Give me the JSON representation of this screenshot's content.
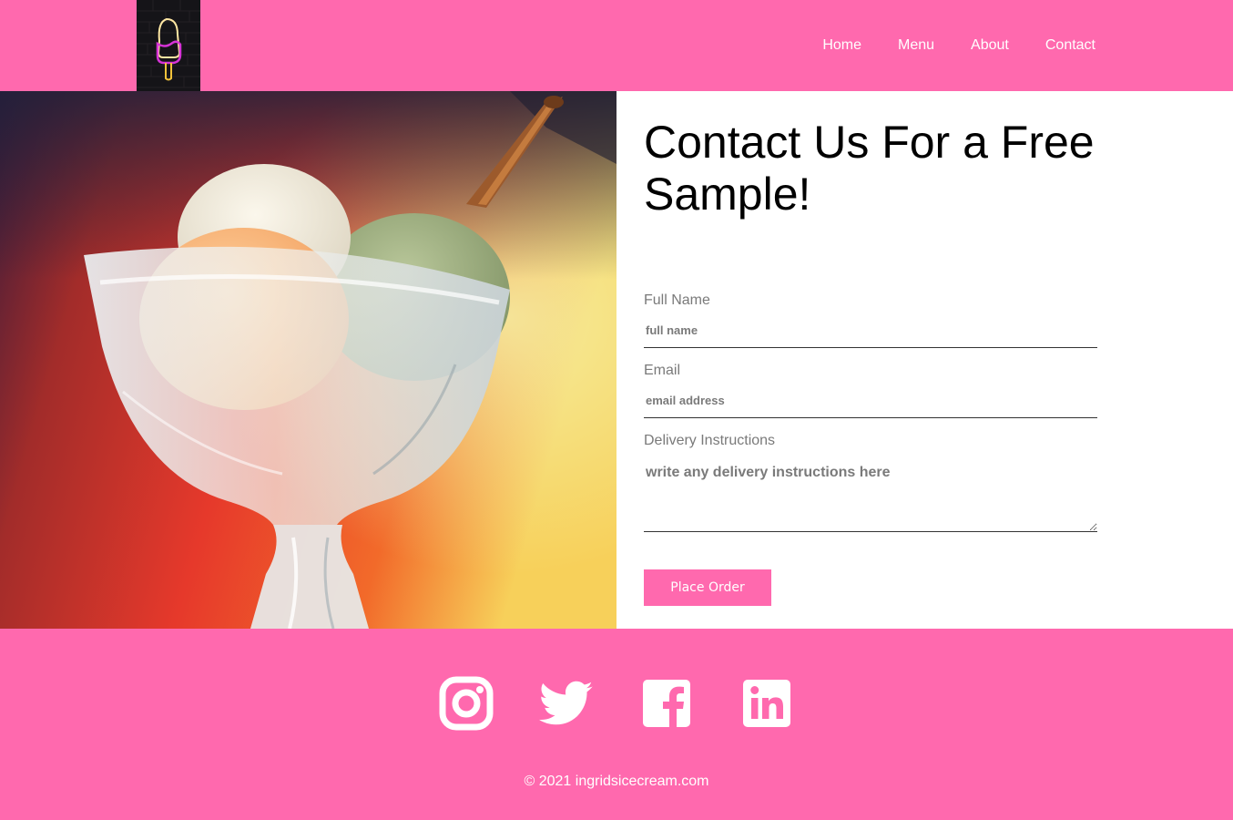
{
  "header": {
    "logo_icon": "neon-popsicle-icon",
    "nav": [
      "Home",
      "Menu",
      "About",
      "Contact"
    ]
  },
  "hero": {
    "image": "ice-cream-sundae-glass"
  },
  "form": {
    "title": "Contact Us For a Free Sample!",
    "fields": [
      {
        "label": "Full Name",
        "placeholder": "full name"
      },
      {
        "label": "Email",
        "placeholder": "email address"
      },
      {
        "label": "Delivery Instructions",
        "placeholder": "write any delivery instructions here"
      }
    ],
    "submit_label": "Place Order"
  },
  "footer": {
    "social": [
      "instagram-icon",
      "twitter-icon",
      "facebook-icon",
      "linkedin-icon"
    ],
    "copyright": "© 2021 ingridsicecream.com"
  },
  "colors": {
    "brand_pink": "#ff69ae",
    "logo_bg": "#151418",
    "text_dark": "#000000",
    "label_gray": "#7a7a7a"
  }
}
